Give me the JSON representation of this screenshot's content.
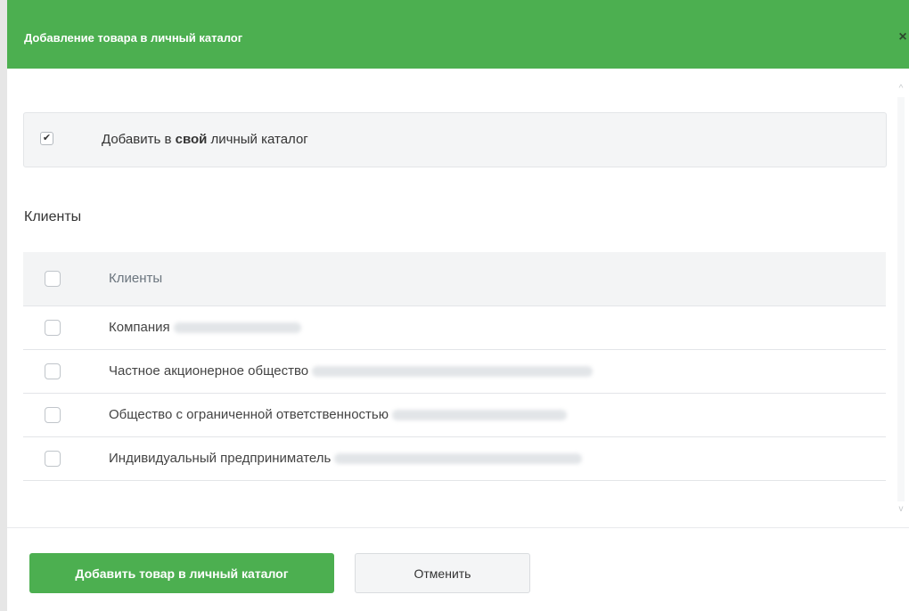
{
  "dialog": {
    "title": "Добавление товара в личный каталог",
    "close_icon": "close-icon",
    "close_glyph": "×"
  },
  "self_catalog": {
    "checked": true,
    "check_glyph": "✔",
    "label_prefix": "Добавить в ",
    "label_bold": "свой",
    "label_suffix": " личный каталог"
  },
  "clients_section": {
    "title": "Клиенты",
    "table_header": "Клиенты",
    "rows": [
      {
        "label": "Компания",
        "checked": false
      },
      {
        "label": "Частное акционерное общество",
        "checked": false
      },
      {
        "label": "Общество с ограниченной ответственностью",
        "checked": false
      },
      {
        "label": "Индивидуальный предприниматель",
        "checked": false
      }
    ]
  },
  "scrollbar": {
    "up_glyph": "^",
    "down_glyph": "v"
  },
  "footer": {
    "submit_label": "Добавить товар в личный каталог",
    "cancel_label": "Отменить"
  },
  "colors": {
    "accent": "#4caf50",
    "header_text": "#ffffff"
  }
}
